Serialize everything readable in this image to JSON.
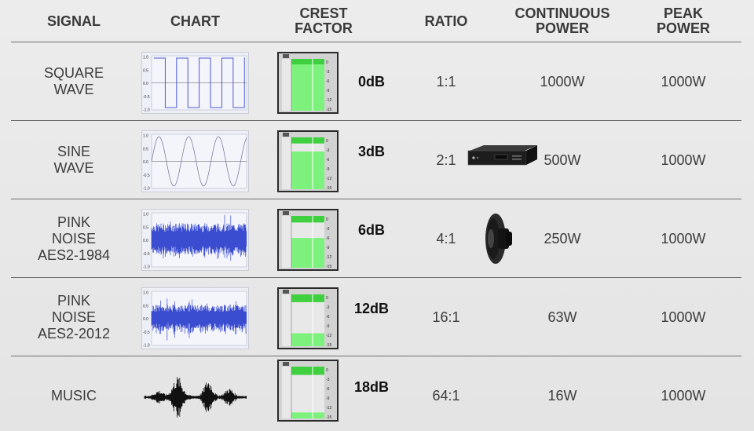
{
  "headers": {
    "signal": "SIGNAL",
    "chart": "CHART",
    "crest_factor": "CREST\nFACTOR",
    "ratio": "RATIO",
    "continuous_power": "CONTINUOUS\nPOWER",
    "peak_power": "PEAK\nPOWER"
  },
  "rows": [
    {
      "signal": "SQUARE\nWAVE",
      "chart_type": "square",
      "axis_ticks": [
        "1.0",
        "0.5",
        "0.0",
        "-0.5",
        "-1.0"
      ],
      "crest_factor": "0dB",
      "meter_level": 1.0,
      "ratio": "1:1",
      "continuous_power": "1000W",
      "peak_power": "1000W"
    },
    {
      "signal": "SINE\nWAVE",
      "chart_type": "sine",
      "axis_ticks": [
        "1.0",
        "0.5",
        "0.0",
        "-0.5",
        "-1.0"
      ],
      "crest_factor": "3dB",
      "meter_level": 0.82,
      "ratio": "2:1",
      "continuous_power": "500W",
      "peak_power": "1000W"
    },
    {
      "signal": "PINK\nNOISE\nAES2-1984",
      "chart_type": "noise",
      "axis_ticks": [
        "1.0",
        "0.5",
        "0.0",
        "-0.5",
        "-1.0"
      ],
      "crest_factor": "6dB",
      "meter_level": 0.65,
      "ratio": "4:1",
      "continuous_power": "250W",
      "peak_power": "1000W"
    },
    {
      "signal": "PINK\nNOISE\nAES2-2012",
      "chart_type": "noise",
      "axis_ticks": [
        "1.0",
        "0.5",
        "0.0",
        "-0.5",
        "-1.0"
      ],
      "crest_factor": "12dB",
      "meter_level": 0.28,
      "ratio": "16:1",
      "continuous_power": "63W",
      "peak_power": "1000W"
    },
    {
      "signal": "MUSIC",
      "chart_type": "music",
      "axis_ticks": [],
      "crest_factor": "18dB",
      "meter_level": 0.12,
      "ratio": "64:1",
      "continuous_power": "16W",
      "peak_power": "1000W"
    }
  ],
  "meter_scale": [
    "0",
    "-3",
    "-6",
    "-9",
    "-12",
    "-15"
  ],
  "product_icons": [
    "power-amplifier",
    "loudspeaker-driver"
  ],
  "colors": {
    "meter_peak": "#3fd03f",
    "meter_fill": "#7cf27c",
    "waveform": "#4a5bd4",
    "music_wave": "#111111"
  }
}
